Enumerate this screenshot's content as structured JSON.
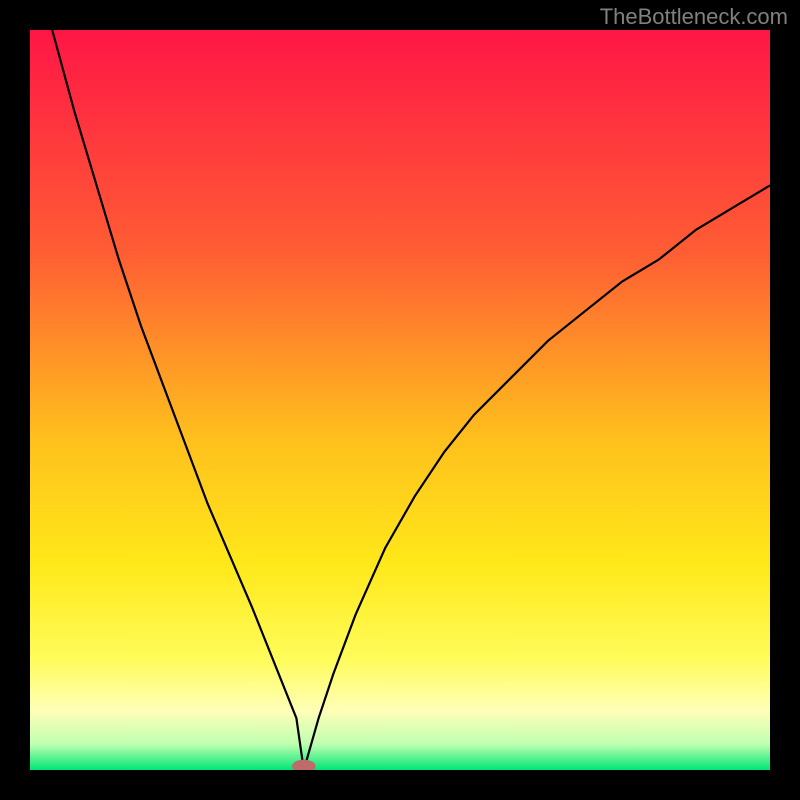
{
  "watermark": "TheBottleneck.com",
  "chart_data": {
    "type": "line",
    "title": "",
    "xlabel": "",
    "ylabel": "",
    "xlim": [
      0,
      100
    ],
    "ylim": [
      0,
      100
    ],
    "grid": false,
    "legend": null,
    "gradient_stops": [
      {
        "offset": 0,
        "color": "#ff1646"
      },
      {
        "offset": 0.3,
        "color": "#ff5d34"
      },
      {
        "offset": 0.55,
        "color": "#ffbf1d"
      },
      {
        "offset": 0.72,
        "color": "#ffe819"
      },
      {
        "offset": 0.85,
        "color": "#fffc5a"
      },
      {
        "offset": 0.92,
        "color": "#ffffb8"
      },
      {
        "offset": 0.965,
        "color": "#bfffb0"
      },
      {
        "offset": 1.0,
        "color": "#00e676"
      }
    ],
    "series": [
      {
        "name": "bottleneck-curve",
        "x": [
          3,
          6,
          9,
          12,
          15,
          18,
          21,
          24,
          27,
          30,
          32,
          34,
          36,
          37,
          39,
          41,
          44,
          48,
          52,
          56,
          60,
          65,
          70,
          75,
          80,
          85,
          90,
          95,
          100
        ],
        "values": [
          100,
          89,
          79,
          69,
          60,
          52,
          44,
          36,
          29,
          22,
          17,
          12,
          7,
          0,
          7,
          13,
          21,
          30,
          37,
          43,
          48,
          53,
          58,
          62,
          66,
          69,
          73,
          76,
          79
        ]
      }
    ],
    "marker": {
      "name": "optimum-marker",
      "x": 37,
      "y": 0.5,
      "rx_pct": 1.6,
      "ry_pct": 0.9,
      "fill": "#bd6b6b"
    }
  }
}
